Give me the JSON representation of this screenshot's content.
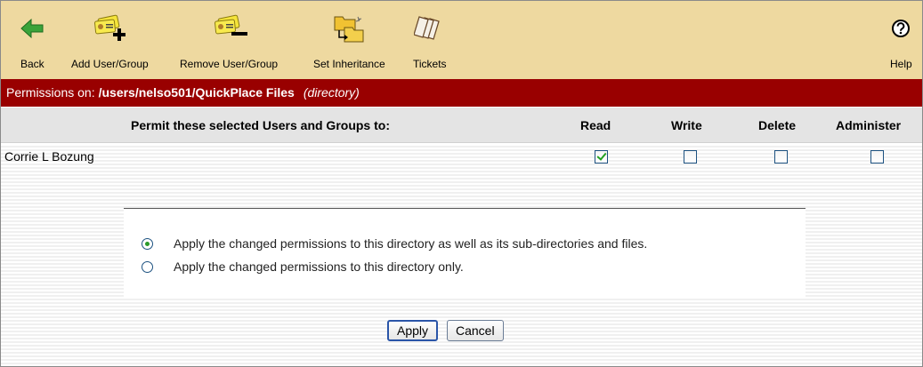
{
  "toolbar": {
    "items": [
      {
        "label": "Back",
        "icon": "back-arrow-icon"
      },
      {
        "label": "Add User/Group",
        "icon": "add-user-group-icon"
      },
      {
        "label": "Remove User/Group",
        "icon": "remove-user-group-icon"
      },
      {
        "label": "Set Inheritance",
        "icon": "set-inheritance-icon"
      },
      {
        "label": "Tickets",
        "icon": "tickets-icon"
      }
    ],
    "help": {
      "label": "Help",
      "icon": "help-icon"
    }
  },
  "titlebar": {
    "prefix": "Permissions on:",
    "path": "/users/nelso501/QuickPlace Files",
    "kind": "(directory)"
  },
  "table": {
    "header": "Permit these selected Users and Groups to:",
    "columns": [
      "Read",
      "Write",
      "Delete",
      "Administer"
    ],
    "rows": [
      {
        "name": "Corrie L Bozung",
        "read": true,
        "write": false,
        "delete": false,
        "administer": false
      }
    ]
  },
  "options": {
    "items": [
      {
        "label": "Apply the changed permissions to this directory as well as its sub-directories and files.",
        "selected": true
      },
      {
        "label": "Apply the changed permissions to this directory only.",
        "selected": false
      }
    ]
  },
  "buttons": {
    "apply": "Apply",
    "cancel": "Cancel"
  },
  "colors": {
    "toolbar_bg": "#eed9a0",
    "titlebar_bg": "#990000",
    "header_bg": "#e4e4e4"
  }
}
